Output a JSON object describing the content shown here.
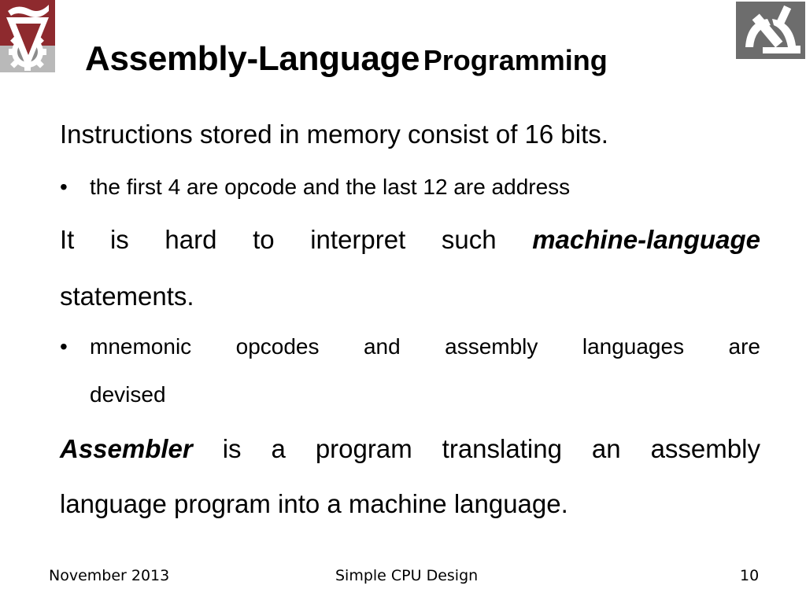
{
  "slide": {
    "title_main": "Assembly-Language",
    "title_secondary": "Programming",
    "logos": {
      "left": "technion-logo",
      "right": "department-logo"
    },
    "content": {
      "line1": "Instructions stored in memory consist of 16 bits.",
      "bullet1": "the first 4 are opcode and the last 12 are address",
      "line2_words": [
        "It",
        "is",
        "hard",
        "to",
        "interpret",
        "such"
      ],
      "line2_emphasis": "machine-language",
      "line3": "statements.",
      "bullet2_words": [
        "mnemonic",
        "opcodes",
        "and",
        "assembly",
        "languages",
        "are"
      ],
      "bullet2_cont": "devised",
      "line4_emphasis": "Assembler",
      "line4_words": [
        "is",
        "a",
        "program",
        "translating",
        "an",
        "assembly"
      ],
      "line5": "language program into a machine language.",
      "bullet_char": "•"
    },
    "footer": {
      "date": "November 2013",
      "title": "Simple CPU Design",
      "page": "10"
    }
  }
}
